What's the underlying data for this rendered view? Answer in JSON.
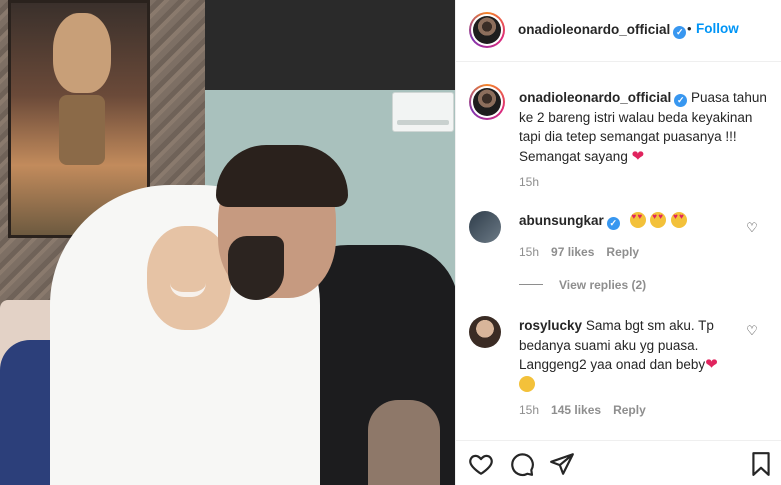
{
  "post": {
    "username": "onadioleonardo_official",
    "follow_label": "Follow",
    "dot": "•",
    "verified_mark": "✓"
  },
  "caption": {
    "username": "onadioleonardo_official",
    "text": "Puasa tahun ke 2 bareng istri walau beda keyakinan tapi dia tetep semangat puasanya !!! Semangat sayang",
    "heart": "❤",
    "time": "15h"
  },
  "comments": [
    {
      "username": "abunsungkar",
      "verified": true,
      "emoji_count": 3,
      "time": "15h",
      "likes": "97 likes",
      "reply": "Reply"
    },
    {
      "username": "rosylucky",
      "verified": false,
      "text": "Sama bgt sm aku. Tp bedanya suami aku yg puasa. Langgeng2 yaa onad dan beby",
      "heart": "❤",
      "time": "15h",
      "likes": "145 likes",
      "reply": "Reply"
    }
  ],
  "view_replies": "View replies (2)",
  "icons": {
    "like": "heart-icon",
    "comment": "comment-icon",
    "share": "share-icon",
    "save": "bookmark-icon"
  },
  "colors": {
    "accent": "#0095f6",
    "verified": "#3897f0",
    "muted": "#8e8e8e",
    "heart": "#e0245e"
  }
}
